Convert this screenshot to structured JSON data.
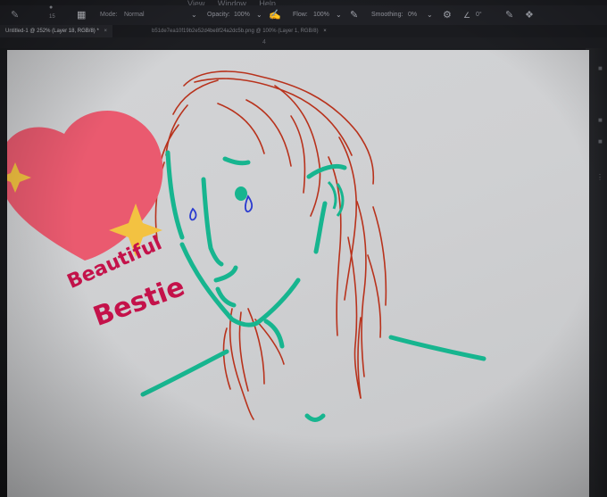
{
  "toolbar": {
    "brush_size": "15",
    "mode_label": "Mode:",
    "mode_value": "Normal",
    "opacity_label": "Opacity:",
    "opacity_value": "100%",
    "flow_label": "Flow:",
    "flow_value": "100%",
    "smoothing_label": "Smoothing:",
    "smoothing_value": "0%",
    "angle_value": "0°"
  },
  "menu_fragment": [
    "View",
    "Window",
    "Help"
  ],
  "tabs": [
    {
      "label": "Untitled-1 @ 252% (Layer 18, RGB/8) *"
    },
    {
      "label": "b51de7ea10f19b2e52d4be8f24a2dc5b.png @ 100% (Layer 1, RGB/8)"
    }
  ],
  "ruler": {
    "mark": "4"
  },
  "artwork": {
    "text_line_1": "Beautiful",
    "text_line_2": "Bestie",
    "colors": {
      "hair": "#b8321c",
      "face": "#17b58f",
      "tear": "#2a3bd0",
      "text": "#c4124a",
      "heart": "#ea5a6f",
      "sparkle": "#f3c241"
    }
  }
}
